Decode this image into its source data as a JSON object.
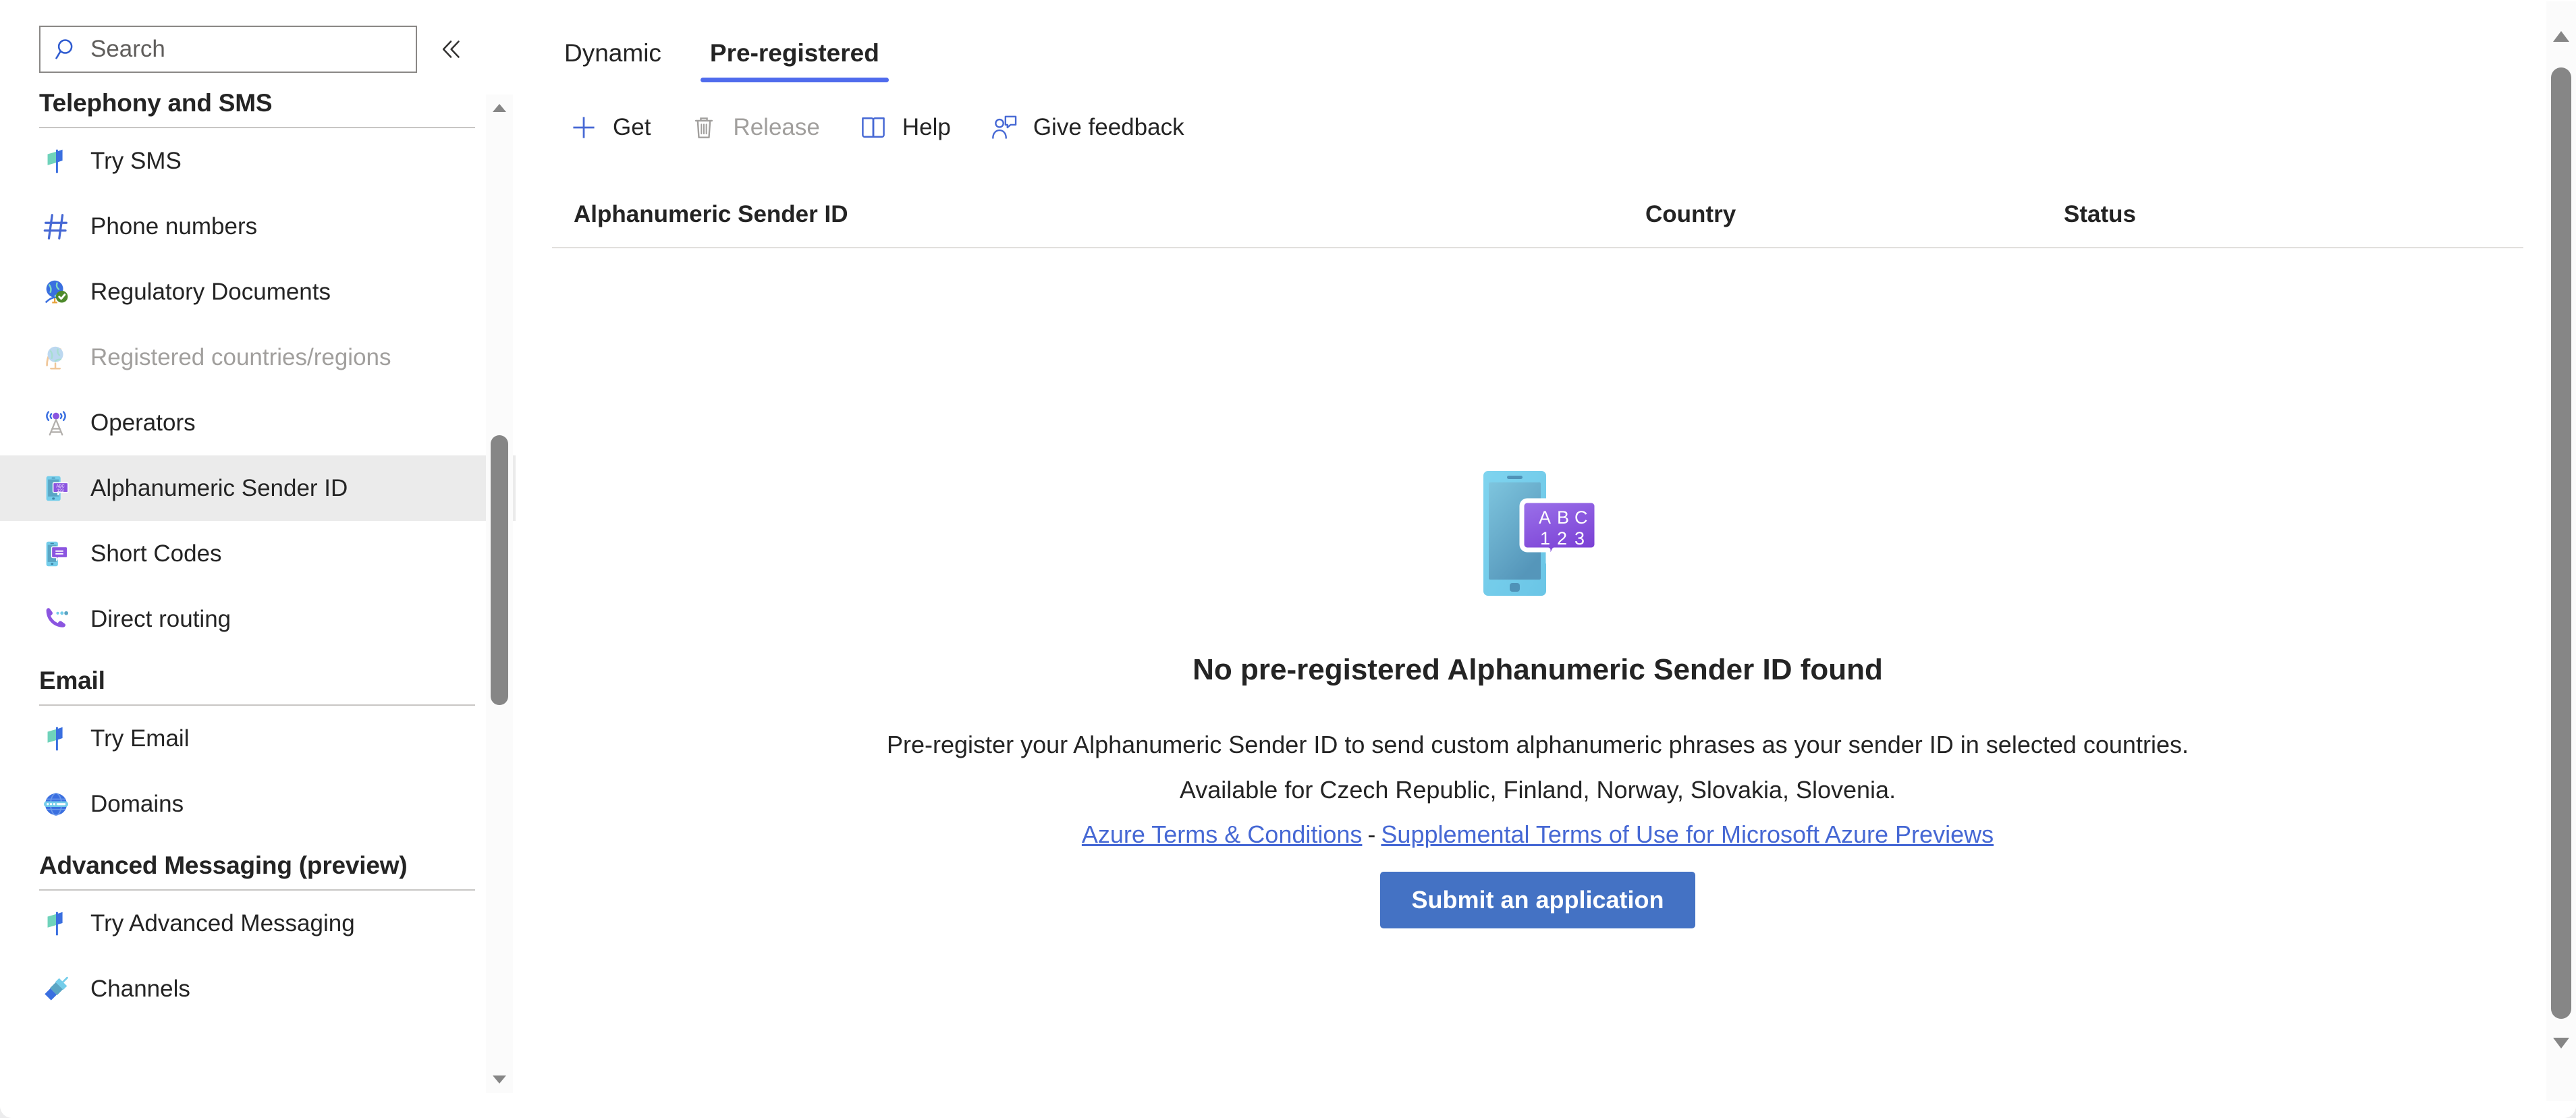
{
  "sidebar": {
    "search": {
      "placeholder": "Search",
      "value": "",
      "icon": "search-icon"
    },
    "collapse_icon": "chevron-double-left-icon",
    "groups": [
      {
        "title": "Telephony and SMS",
        "items": [
          {
            "label": "Try SMS",
            "icon": "flag-icon",
            "selected": false,
            "disabled": false
          },
          {
            "label": "Phone numbers",
            "icon": "hash-icon",
            "selected": false,
            "disabled": false
          },
          {
            "label": "Regulatory Documents",
            "icon": "globe-check-icon",
            "selected": false,
            "disabled": false
          },
          {
            "label": "Registered countries/regions",
            "icon": "globe-stand-icon",
            "selected": false,
            "disabled": true
          },
          {
            "label": "Operators",
            "icon": "antenna-tower-icon",
            "selected": false,
            "disabled": false
          },
          {
            "label": "Alphanumeric Sender ID",
            "icon": "phone-abc123-icon",
            "selected": true,
            "disabled": false
          },
          {
            "label": "Short Codes",
            "icon": "phone-message-icon",
            "selected": false,
            "disabled": false
          },
          {
            "label": "Direct routing",
            "icon": "phone-call-icon",
            "selected": false,
            "disabled": false
          }
        ]
      },
      {
        "title": "Email",
        "items": [
          {
            "label": "Try Email",
            "icon": "flag-icon",
            "selected": false,
            "disabled": false
          },
          {
            "label": "Domains",
            "icon": "globe-domain-icon",
            "selected": false,
            "disabled": false
          }
        ]
      },
      {
        "title": "Advanced Messaging (preview)",
        "items": [
          {
            "label": "Try Advanced Messaging",
            "icon": "flag-icon",
            "selected": false,
            "disabled": false
          },
          {
            "label": "Channels",
            "icon": "plug-icon",
            "selected": false,
            "disabled": false
          }
        ]
      }
    ],
    "scrollbar": {
      "up_icon": "scroll-up-arrow-icon",
      "down_icon": "scroll-down-arrow-icon"
    }
  },
  "main": {
    "tabs": [
      {
        "label": "Dynamic",
        "active": false
      },
      {
        "label": "Pre-registered",
        "active": true
      }
    ],
    "toolbar": [
      {
        "label": "Get",
        "icon": "plus-icon",
        "disabled": false
      },
      {
        "label": "Release",
        "icon": "trash-icon",
        "disabled": true
      },
      {
        "label": "Help",
        "icon": "book-icon",
        "disabled": false
      },
      {
        "label": "Give feedback",
        "icon": "person-feedback-icon",
        "disabled": false
      }
    ],
    "table": {
      "columns": [
        "Alphanumeric Sender ID",
        "Country",
        "Status"
      ],
      "rows": []
    },
    "empty_state": {
      "illustration": "phone-abc123-illustration",
      "title": "No pre-registered Alphanumeric Sender ID found",
      "description": "Pre-register your Alphanumeric Sender ID to send custom alphanumeric phrases as your sender ID in selected countries.",
      "availability": "Available for Czech Republic, Finland, Norway, Slovakia, Slovenia.",
      "link_terms": "Azure Terms & Conditions",
      "link_separator": "-",
      "link_preview": "Supplemental Terms of Use for Microsoft Azure Previews",
      "submit_label": "Submit an application"
    },
    "scrollbar": {
      "up_icon": "scroll-up-arrow-icon",
      "down_icon": "scroll-down-arrow-icon"
    }
  },
  "colors": {
    "accent": "#4f6bed",
    "link": "#4668d4",
    "primary_button": "#4472c4",
    "selected_row": "#ebebeb",
    "disabled_text": "#a19f9d"
  }
}
